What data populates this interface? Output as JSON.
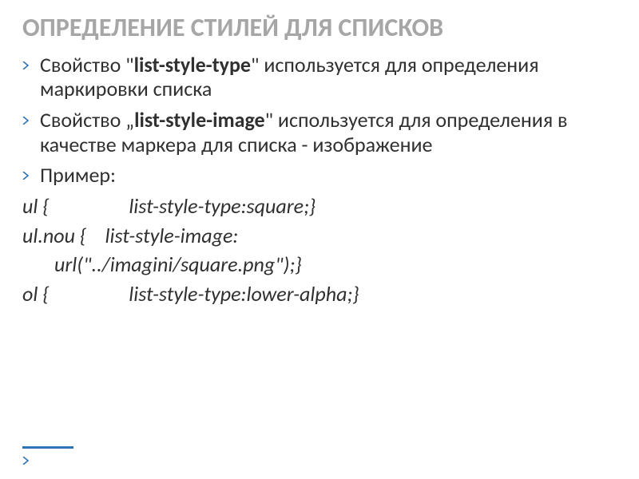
{
  "title": "ОПРЕДЕЛЕНИЕ СТИЛЕЙ ДЛЯ СПИСКОВ",
  "bullets": [
    {
      "parts": [
        {
          "t": "Свойство \""
        },
        {
          "t": "list-style-type",
          "b": true
        },
        {
          "t": "\" используется для определения маркировки списка"
        }
      ]
    },
    {
      "parts": [
        {
          "t": "Свойство „"
        },
        {
          "t": "list-style-image",
          "b": true
        },
        {
          "t": "\" используется для определения в качестве маркера для списка - изображение"
        }
      ]
    },
    {
      "parts": [
        {
          "t": "Пример:"
        }
      ]
    }
  ],
  "code": {
    "l1": "ul {                 list-style-type:square;}",
    "l2a": "ul.nou {    list-style-image:",
    "l2b": "url(\"../imagini/square.png\");}",
    "l3": "ol {                 list-style-type:lower-alpha;}"
  }
}
